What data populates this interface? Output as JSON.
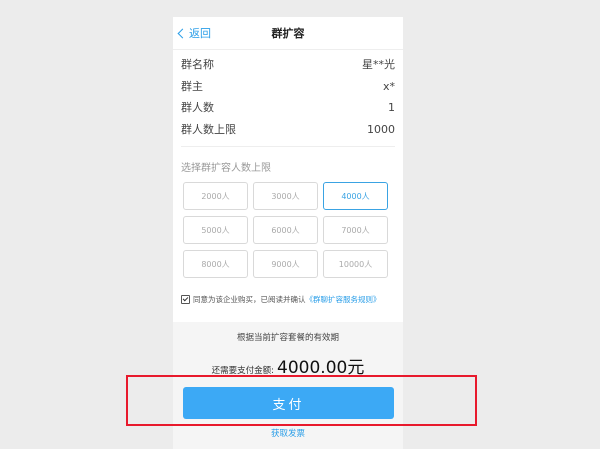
{
  "header": {
    "back_label": "返回",
    "title": "群扩容"
  },
  "info": [
    {
      "label": "群名称",
      "value": "星**光"
    },
    {
      "label": "群主",
      "value": "x*"
    },
    {
      "label": "群人数",
      "value": "1"
    },
    {
      "label": "群人数上限",
      "value": "1000"
    }
  ],
  "section_title": "选择群扩容人数上限",
  "options": [
    "2000人",
    "3000人",
    "4000人",
    "5000人",
    "6000人",
    "7000人",
    "8000人",
    "9000人",
    "10000人"
  ],
  "selected_option": "4000人",
  "agreement": {
    "checked": true,
    "text": "同意为该企业购买，已阅读并确认",
    "link": "《群聊扩容服务规则》"
  },
  "payment": {
    "note": "根据当前扩容套餐的有效期",
    "amount_label": "还需要支付金额:",
    "amount_value": "4000.00元",
    "pay_button": "支付",
    "invoice_link": "获取发票"
  },
  "colors": {
    "accent": "#3ca9f5",
    "highlight_box": "#e8192c"
  }
}
